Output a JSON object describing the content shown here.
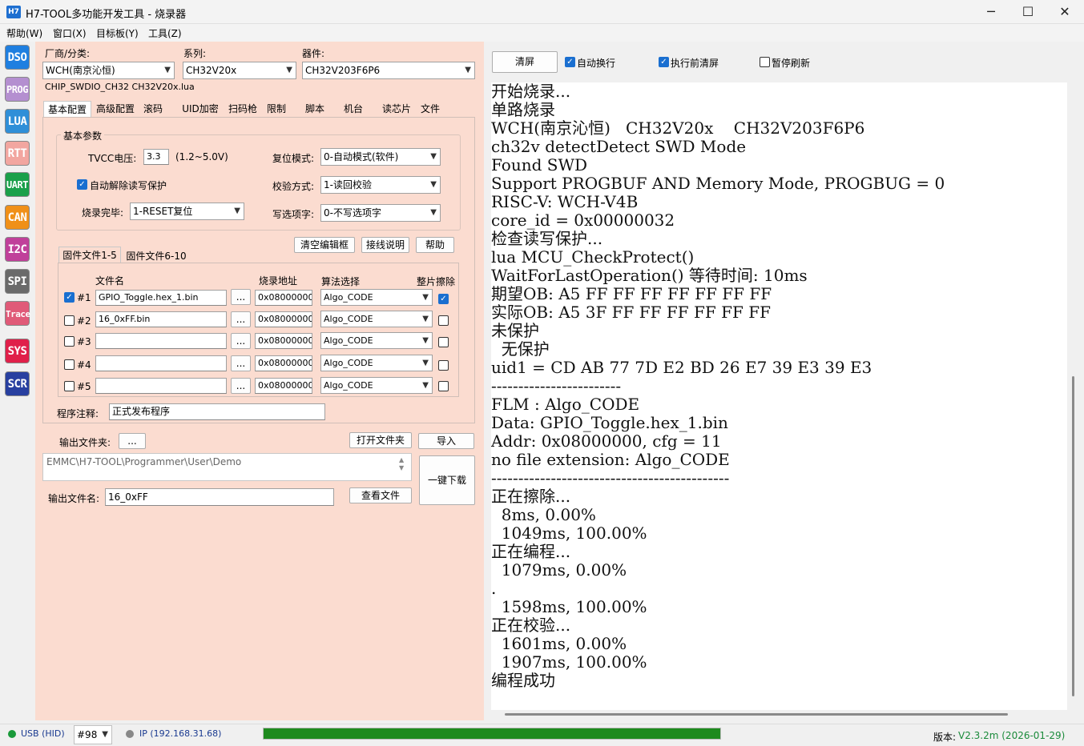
{
  "window": {
    "title": "H7-TOOL多功能开发工具 - 烧录器",
    "app_icon": "H7",
    "minimize": "─",
    "maximize": "☐",
    "close": "✕"
  },
  "menu": [
    "帮助(W)",
    "窗口(X)",
    "目标板(Y)",
    "工具(Z)"
  ],
  "sidebar": [
    {
      "label": "DSO",
      "color": "#1f7fe0"
    },
    {
      "label": "PROG",
      "color": "#b48fd0"
    },
    {
      "label": "LUA",
      "color": "#2f8fd8"
    },
    {
      "label": "RTT",
      "color": "#f2a6a0"
    },
    {
      "label": "UART",
      "color": "#1aa04a"
    },
    {
      "label": "CAN",
      "color": "#f09018"
    },
    {
      "label": "I2C",
      "color": "#c0409a"
    },
    {
      "label": "SPI",
      "color": "#6a6a6a"
    },
    {
      "label": "Trace",
      "color": "#e05a78"
    },
    {
      "label": "SYS",
      "color": "#e0204a"
    },
    {
      "label": "SCR",
      "color": "#2840a0"
    }
  ],
  "device": {
    "vendor_label": "厂商/分类:",
    "vendor_value": "WCH(南京沁恒)",
    "series_label": "系列:",
    "series_value": "CH32V20x",
    "part_label": "器件:",
    "part_value": "CH32V203F6P6",
    "script_info": "CHIP_SWDIO_CH32  CH32V20x.lua"
  },
  "tabs": [
    "基本配置",
    "高级配置",
    "滚码",
    "UID加密",
    "扫码枪",
    "限制",
    "脚本",
    "机台",
    "读芯片",
    "文件"
  ],
  "basic": {
    "group_title": "基本参数",
    "tvcc_label": "TVCC电压:",
    "tvcc_value": "3.3",
    "tvcc_range": "(1.2~5.0V)",
    "reset_label": "复位模式:",
    "reset_value": "0-自动模式(软件)",
    "auto_unlock_label": "自动解除读写保护",
    "auto_unlock_checked": true,
    "verify_label": "校验方式:",
    "verify_value": "1-读回校验",
    "done_label": "烧录完毕:",
    "done_value": "1-RESET复位",
    "option_label": "写选项字:",
    "option_value": "0-不写选项字"
  },
  "buttons": {
    "clear_edit": "清空编辑框",
    "wiring": "接线说明",
    "help": "帮助"
  },
  "file_tabs": [
    "固件文件1-5",
    "固件文件6-10"
  ],
  "file_table": {
    "headers": [
      "文件名",
      "烧录地址",
      "算法选择",
      "整片擦除"
    ],
    "rows": [
      {
        "idx": "#1",
        "checked": true,
        "file": "GPIO_Toggle.hex_1.bin",
        "browse": "...",
        "addr": "0x08000000",
        "algo": "Algo_CODE",
        "erase": true
      },
      {
        "idx": "#2",
        "checked": false,
        "file": "16_0xFF.bin",
        "browse": "...",
        "addr": "0x08000000",
        "algo": "Algo_CODE",
        "erase": false
      },
      {
        "idx": "#3",
        "checked": false,
        "file": "",
        "browse": "...",
        "addr": "0x08000000",
        "algo": "Algo_CODE",
        "erase": false
      },
      {
        "idx": "#4",
        "checked": false,
        "file": "",
        "browse": "...",
        "addr": "0x08000000",
        "algo": "Algo_CODE",
        "erase": false
      },
      {
        "idx": "#5",
        "checked": false,
        "file": "",
        "browse": "...",
        "addr": "0x08000000",
        "algo": "Algo_CODE",
        "erase": false
      }
    ]
  },
  "note": {
    "label": "程序注释:",
    "value": "正式发布程序"
  },
  "output": {
    "folder_label": "输出文件夹:",
    "folder_btn": "...",
    "open_folder": "打开文件夹",
    "import": "导入",
    "path": "EMMC\\H7-TOOL\\Programmer\\User\\Demo",
    "one_key": "一键下载",
    "name_label": "输出文件名:",
    "name_value": "16_0xFF",
    "view_file": "查看文件"
  },
  "log_toolbar": {
    "clear": "清屏",
    "auto_wrap": "自动换行",
    "auto_wrap_checked": true,
    "clear_before": "执行前清屏",
    "clear_before_checked": true,
    "pause": "暂停刷新",
    "pause_checked": false
  },
  "log": [
    "开始烧录...",
    "单路烧录",
    "WCH(南京沁恒)   CH32V20x    CH32V203F6P6",
    "ch32v detectDetect SWD Mode",
    "Found SWD",
    "Support PROGBUF AND Memory Mode, PROGBUG = 0",
    "RISC-V: WCH-V4B",
    "core_id = 0x00000032",
    "检查读写保护...",
    "lua MCU_CheckProtect()",
    "WaitForLastOperation() 等待时间: 10ms",
    "期望OB: A5 FF FF FF FF FF FF FF",
    "实际OB: A5 3F FF FF FF FF FF FF",
    "未保护",
    "  无保护",
    "uid1 = CD AB 77 7D E2 BD 26 E7 39 E3 39 E3",
    "------------------------",
    "FLM : Algo_CODE",
    "Data: GPIO_Toggle.hex_1.bin",
    "Addr: 0x08000000, cfg = 11",
    "no file extension: Algo_CODE",
    "--------------------------------------------",
    "正在擦除...",
    "  8ms, 0.00%",
    "  1049ms, 100.00%",
    "正在编程...",
    "  1079ms, 0.00%",
    ".",
    "  1598ms, 100.00%",
    "正在校验...",
    "  1601ms, 0.00%",
    "  1907ms, 100.00%",
    "编程成功"
  ],
  "status": {
    "usb": "USB (HID)",
    "usb_color": "#1a9a3a",
    "device_no": "#98",
    "ip": "IP (192.168.31.68)",
    "ip_color": "#888888",
    "progress": 1.0,
    "progress_color": "#1e8a1e",
    "version_label": "版本:",
    "version_value": "V2.3.2m (2026-01-29)"
  }
}
